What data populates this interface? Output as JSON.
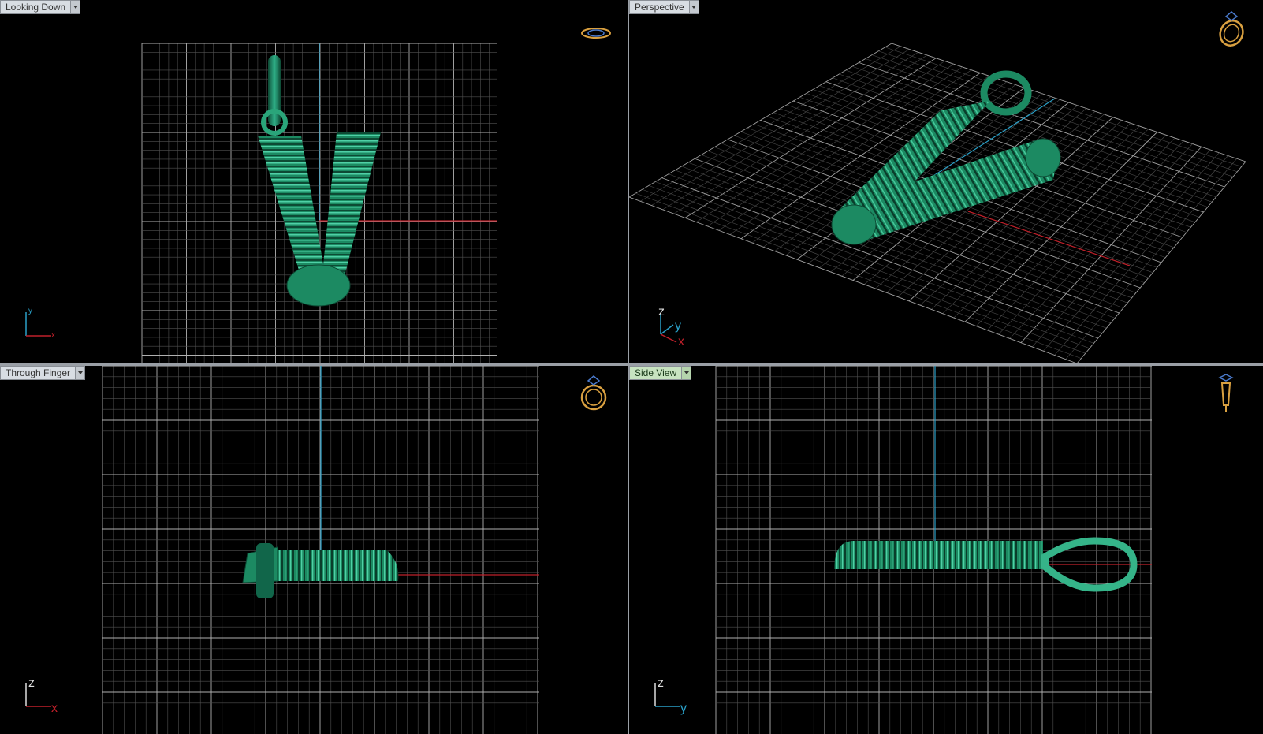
{
  "viewports": {
    "top": {
      "label": "Looking Down",
      "axis_h": "x",
      "axis_v": "y",
      "nav_icon": "ring-top-icon"
    },
    "perspective": {
      "label": "Perspective",
      "axis_z": "z",
      "axis_y": "y",
      "axis_x": "x",
      "nav_icon": "ring-perspective-icon"
    },
    "front": {
      "label": "Through Finger",
      "axis_h": "x",
      "axis_v": "z",
      "nav_icon": "ring-front-icon"
    },
    "side": {
      "label": "Side View",
      "axis_h": "y",
      "axis_v": "z",
      "nav_icon": "ring-side-icon",
      "active": true
    }
  },
  "colors": {
    "model": "#1c8a62",
    "model_dark": "#0d4a34",
    "model_light": "#3fc29a",
    "grid": "#8c8c8c",
    "axis_x": "#c0202a",
    "axis_y": "#2aa0c8",
    "icon_gold": "#d9a040",
    "icon_blue": "#4a7acc"
  }
}
